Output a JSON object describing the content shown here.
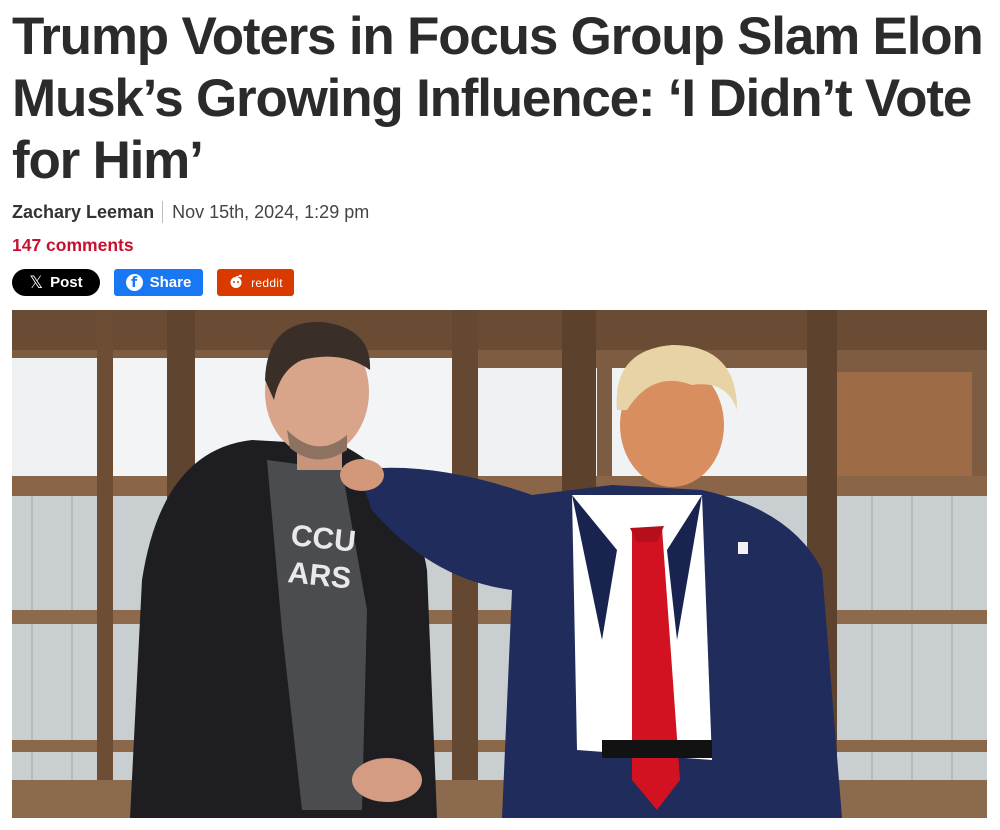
{
  "article": {
    "headline": "Trump Voters in Focus Group Slam Elon Musk’s Growing Influence: ‘I Didn’t Vote for Him’",
    "author": "Zachary Leeman",
    "date": "Nov 15th, 2024, 1:29 pm",
    "comments": "147 comments"
  },
  "share": {
    "x_label": "Post",
    "facebook_label": "Share",
    "reddit_label": "reddit"
  },
  "photo": {
    "shirt_text_line1": "CCU",
    "shirt_text_line2": "ARS"
  },
  "colors": {
    "comments": "#c8102e",
    "x": "#000000",
    "facebook": "#1877f2",
    "reddit": "#d93a00"
  },
  "icons": [
    "x-logo-icon",
    "facebook-icon",
    "reddit-icon"
  ]
}
